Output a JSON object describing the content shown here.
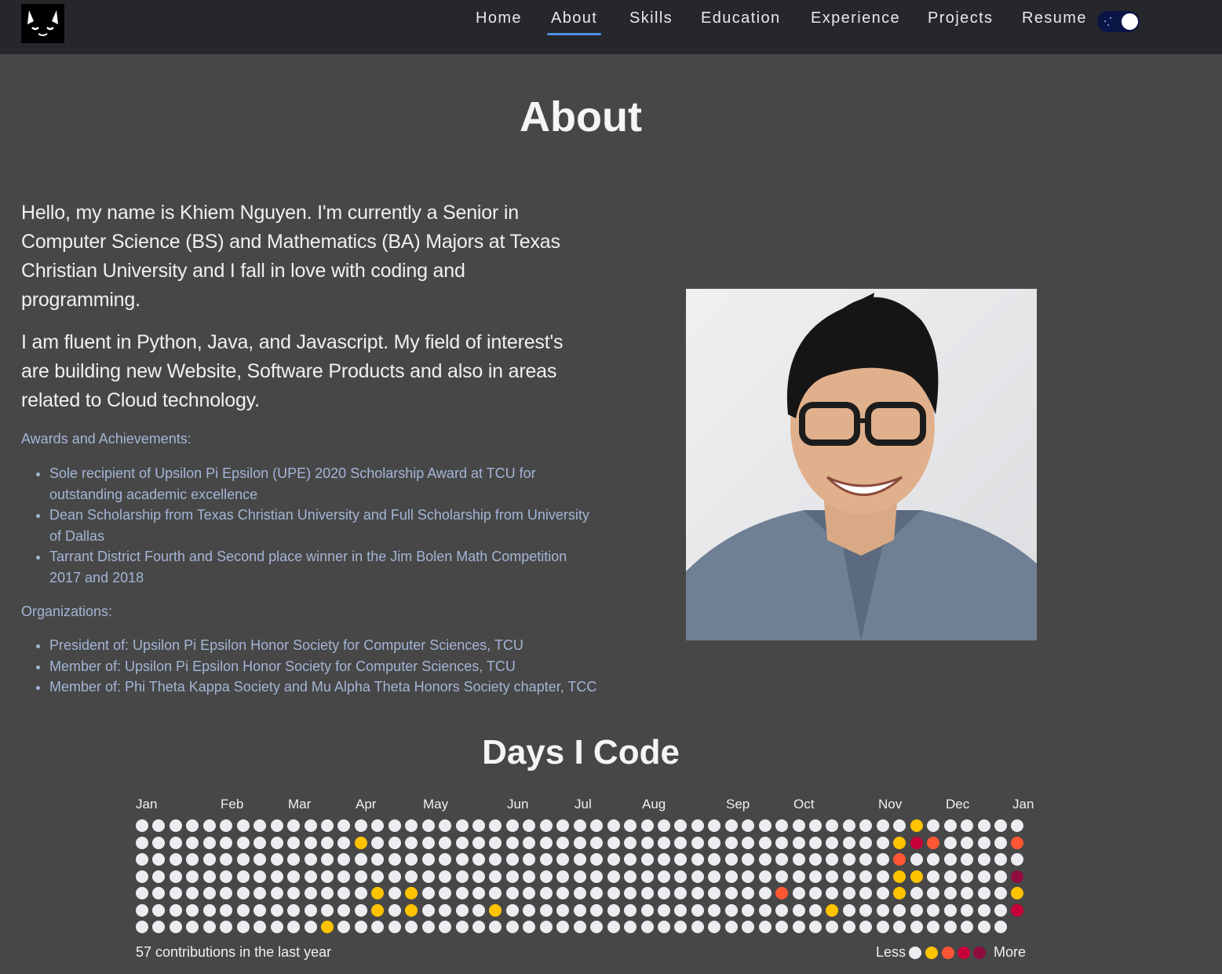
{
  "nav": {
    "items": [
      {
        "label": "Home"
      },
      {
        "label": "About"
      },
      {
        "label": "Skills"
      },
      {
        "label": "Education"
      },
      {
        "label": "Experience"
      },
      {
        "label": "Projects"
      },
      {
        "label": "Resume"
      }
    ],
    "active": "About",
    "theme_toggle": "dark-mode-on"
  },
  "about": {
    "title": "About",
    "intro_1": "Hello, my name is Khiem Nguyen. I'm currently a Senior in Computer Science (BS) and Mathematics (BA) Majors at Texas Christian University and I fall in love with coding and programming.",
    "intro_2": "I am fluent in Python, Java, and Javascript. My field of interest's are building new Website, Software Products and also in areas related to Cloud technology.",
    "awards_label": "Awards and Achievements:",
    "awards": [
      "Sole recipient of Upsilon Pi Epsilon (UPE) 2020 Scholarship Award at TCU for outstanding academic excellence",
      "Dean Scholarship from Texas Christian University and Full Scholarship from University of Dallas",
      "Tarrant District Fourth and Second place winner in the Jim Bolen Math Competition 2017 and 2018"
    ],
    "orgs_label": "Organizations:",
    "orgs": [
      "President of: Upsilon Pi Epsilon Honor Society for Computer Sciences, TCU",
      "Member of: Upsilon Pi Epsilon Honor Society for Computer Sciences, TCU",
      "Member of: Phi Theta Kappa Society and Mu Alpha Theta Honors Society chapter, TCC"
    ]
  },
  "calendar": {
    "title": "Days I Code",
    "months": [
      "Jan",
      "Feb",
      "Mar",
      "Apr",
      "May",
      "Jun",
      "Jul",
      "Aug",
      "Sep",
      "Oct",
      "Nov",
      "Dec",
      "Jan"
    ],
    "total_text": "57 contributions in the last year",
    "legend_less": "Less",
    "legend_more": "More",
    "level_colors": [
      "#ebedf0",
      "#ffc300",
      "#ff5733",
      "#c70039",
      "#900c3f"
    ],
    "weeks": 53,
    "last_week_days": 6,
    "active_days": [
      {
        "week": 13,
        "day": 1,
        "level": 1
      },
      {
        "week": 11,
        "day": 6,
        "level": 1
      },
      {
        "week": 14,
        "day": 4,
        "level": 1
      },
      {
        "week": 14,
        "day": 5,
        "level": 1
      },
      {
        "week": 16,
        "day": 4,
        "level": 1
      },
      {
        "week": 16,
        "day": 5,
        "level": 1
      },
      {
        "week": 21,
        "day": 5,
        "level": 1
      },
      {
        "week": 38,
        "day": 4,
        "level": 2
      },
      {
        "week": 41,
        "day": 5,
        "level": 1
      },
      {
        "week": 45,
        "day": 2,
        "level": 2
      },
      {
        "week": 45,
        "day": 1,
        "level": 1
      },
      {
        "week": 45,
        "day": 3,
        "level": 1
      },
      {
        "week": 45,
        "day": 4,
        "level": 1
      },
      {
        "week": 46,
        "day": 0,
        "level": 1
      },
      {
        "week": 46,
        "day": 1,
        "level": 3
      },
      {
        "week": 46,
        "day": 3,
        "level": 1
      },
      {
        "week": 47,
        "day": 1,
        "level": 2
      },
      {
        "week": 52,
        "day": 1,
        "level": 2
      },
      {
        "week": 52,
        "day": 3,
        "level": 4
      },
      {
        "week": 52,
        "day": 4,
        "level": 1
      },
      {
        "week": 52,
        "day": 5,
        "level": 3
      }
    ]
  }
}
